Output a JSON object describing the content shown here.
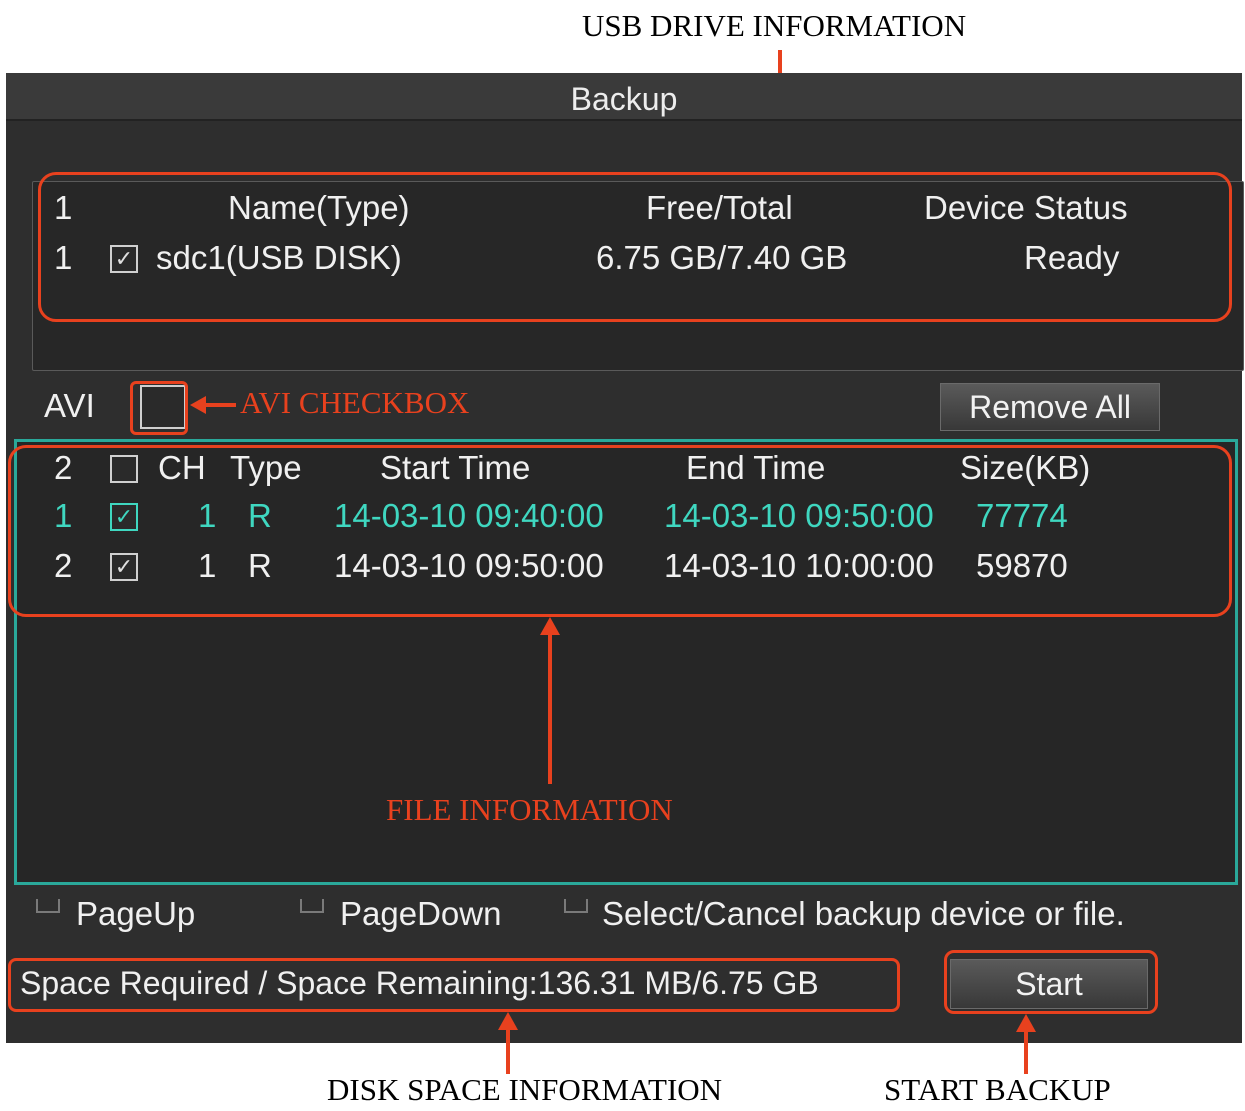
{
  "callouts": {
    "usb": "USB DRIVE INFORMATION",
    "avi": "AVI CHECKBOX",
    "file": "FILE INFORMATION",
    "disk": "DISK SPACE INFORMATION",
    "start": "START BACKUP"
  },
  "window": {
    "title": "Backup"
  },
  "devices": {
    "headers": {
      "count": "1",
      "name": "Name(Type)",
      "free_total": "Free/Total",
      "status": "Device Status"
    },
    "rows": [
      {
        "index": "1",
        "checked": true,
        "name": "sdc1(USB DISK)",
        "free_total": "6.75 GB/7.40 GB",
        "status": "Ready"
      }
    ]
  },
  "avi": {
    "label": "AVI",
    "checked": false
  },
  "remove_all_label": "Remove All",
  "files": {
    "headers": {
      "count": "2",
      "ch": "CH",
      "type": "Type",
      "start": "Start Time",
      "end": "End Time",
      "size": "Size(KB)"
    },
    "rows": [
      {
        "index": "1",
        "checked": true,
        "ch": "1",
        "type": "R",
        "start": "14-03-10 09:40:00",
        "end": "14-03-10 09:50:00",
        "size": "77774",
        "highlighted": true
      },
      {
        "index": "2",
        "checked": true,
        "ch": "1",
        "type": "R",
        "start": "14-03-10 09:50:00",
        "end": "14-03-10 10:00:00",
        "size": "59870",
        "highlighted": false
      }
    ]
  },
  "hints": {
    "page_up": "PageUp",
    "page_down": "PageDown",
    "select": "Select/Cancel backup device or file."
  },
  "space_info": "Space Required / Space Remaining:136.31 MB/6.75 GB",
  "start_label": "Start",
  "colors": {
    "annotation": "#e8411e",
    "highlight": "#3fd7c0",
    "panel": "#2e2e2e"
  }
}
